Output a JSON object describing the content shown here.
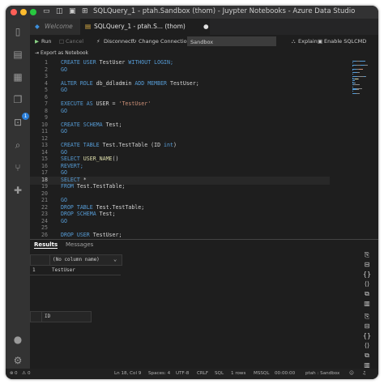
{
  "window": {
    "title": "SQLQuery_1 - ptah.Sandbox (thom) - Juypter Notebooks - Azure Data Studio"
  },
  "titlebar_icons": [
    "sidebar-toggle-icon",
    "split-icon",
    "panel-icon",
    "layout-icon"
  ],
  "tabs": [
    {
      "label": "Welcome",
      "active": false
    },
    {
      "label": "SQLQuery_1 - ptah.S... (thom)",
      "active": true,
      "dirty_marker": "●"
    }
  ],
  "toolbar": {
    "run_label": "Run",
    "cancel_label": "Cancel",
    "disconnect_label": "Disconnect",
    "change_connection_label": "Change Connection",
    "database_value": "Sandbox",
    "explain_label": "Explain",
    "enable_sqlcmd_label": "Enable SQLCMD"
  },
  "export_label": "Export as Notebook",
  "editor": {
    "current_line": "18",
    "lines": [
      {
        "n": "1",
        "tokens": [
          {
            "t": "CREATE USER ",
            "k": "kw"
          },
          {
            "t": "TestUser ",
            "k": ""
          },
          {
            "t": "WITHOUT LOGIN;",
            "k": "kw"
          }
        ]
      },
      {
        "n": "2",
        "tokens": [
          {
            "t": "GO",
            "k": "kw"
          }
        ]
      },
      {
        "n": "3",
        "tokens": []
      },
      {
        "n": "4",
        "tokens": [
          {
            "t": "ALTER ROLE ",
            "k": "kw"
          },
          {
            "t": "db_ddladmin ",
            "k": ""
          },
          {
            "t": "ADD MEMBER ",
            "k": "kw"
          },
          {
            "t": "TestUser;",
            "k": ""
          }
        ]
      },
      {
        "n": "5",
        "tokens": [
          {
            "t": "GO",
            "k": "kw"
          }
        ]
      },
      {
        "n": "6",
        "tokens": []
      },
      {
        "n": "7",
        "tokens": [
          {
            "t": "EXECUTE AS ",
            "k": "kw"
          },
          {
            "t": "USER = ",
            "k": ""
          },
          {
            "t": "'TestUser'",
            "k": "str"
          }
        ]
      },
      {
        "n": "8",
        "tokens": [
          {
            "t": "GO",
            "k": "kw"
          }
        ]
      },
      {
        "n": "9",
        "tokens": []
      },
      {
        "n": "10",
        "tokens": [
          {
            "t": "CREATE SCHEMA ",
            "k": "kw"
          },
          {
            "t": "Test;",
            "k": ""
          }
        ]
      },
      {
        "n": "11",
        "tokens": [
          {
            "t": "GO",
            "k": "kw"
          }
        ]
      },
      {
        "n": "12",
        "tokens": []
      },
      {
        "n": "13",
        "tokens": [
          {
            "t": "CREATE TABLE ",
            "k": "kw"
          },
          {
            "t": "Test.TestTable (ID ",
            "k": ""
          },
          {
            "t": "int",
            "k": "kw"
          },
          {
            "t": ")",
            "k": ""
          }
        ]
      },
      {
        "n": "14",
        "tokens": [
          {
            "t": "GO",
            "k": "kw"
          }
        ]
      },
      {
        "n": "15",
        "tokens": [
          {
            "t": "SELECT ",
            "k": "kw"
          },
          {
            "t": "USER_NAME",
            "k": "fn"
          },
          {
            "t": "()",
            "k": ""
          }
        ]
      },
      {
        "n": "16",
        "tokens": [
          {
            "t": "REVERT;",
            "k": "kw"
          }
        ]
      },
      {
        "n": "17",
        "tokens": [
          {
            "t": "GO",
            "k": "kw"
          }
        ]
      },
      {
        "n": "18",
        "tokens": [
          {
            "t": "SELECT ",
            "k": "kw"
          },
          {
            "t": "*",
            "k": ""
          }
        ]
      },
      {
        "n": "19",
        "tokens": [
          {
            "t": "FROM ",
            "k": "kw"
          },
          {
            "t": "Test.TestTable;",
            "k": ""
          }
        ]
      },
      {
        "n": "20",
        "tokens": []
      },
      {
        "n": "21",
        "tokens": [
          {
            "t": "GO",
            "k": "kw"
          }
        ]
      },
      {
        "n": "22",
        "tokens": [
          {
            "t": "DROP TABLE ",
            "k": "kw"
          },
          {
            "t": "Test.TestTable;",
            "k": ""
          }
        ]
      },
      {
        "n": "23",
        "tokens": [
          {
            "t": "DROP SCHEMA ",
            "k": "kw"
          },
          {
            "t": "Test;",
            "k": ""
          }
        ]
      },
      {
        "n": "24",
        "tokens": [
          {
            "t": "GO",
            "k": "kw"
          }
        ]
      },
      {
        "n": "25",
        "tokens": []
      },
      {
        "n": "26",
        "tokens": [
          {
            "t": "DROP USER ",
            "k": "kw"
          },
          {
            "t": "TestUser;",
            "k": ""
          }
        ]
      }
    ]
  },
  "results": {
    "tabs": [
      "Results",
      "Messages"
    ],
    "grid1": {
      "header": "(No column name)",
      "row_number": "1",
      "value": "TestUser"
    },
    "grid2": {
      "header": "ID"
    }
  },
  "statusbar": {
    "errors": "0",
    "warnings": "0",
    "position": "Ln 18, Col 9",
    "spaces": "Spaces: 4",
    "encoding": "UTF-8",
    "eol": "CRLF",
    "language": "SQL",
    "rows": "1 rows",
    "kind": "MSSQL",
    "time": "00:00:00",
    "connection": "ptah : Sandbox"
  },
  "colors": {
    "keyword": "#569cd6",
    "string": "#ce9178",
    "function": "#dcdcaa",
    "accent": "#2b7fd9",
    "close": "#ff5f57",
    "minimize": "#febc2e",
    "maximize": "#28c840"
  }
}
